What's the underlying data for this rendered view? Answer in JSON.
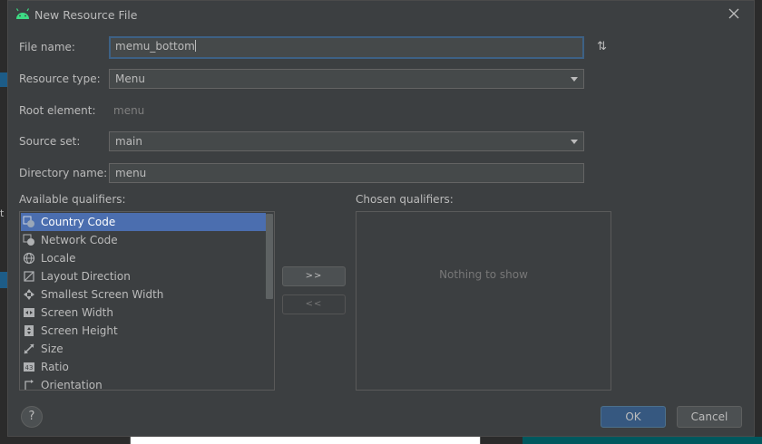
{
  "dialog": {
    "title": "New Resource File",
    "icon": "android-icon"
  },
  "form": {
    "file_name_label": "File name:",
    "file_name_value": "memu_bottom",
    "resource_type_label": "Resource type:",
    "resource_type_value": "Menu",
    "root_element_label": "Root element:",
    "root_element_value": "menu",
    "source_set_label": "Source set:",
    "source_set_value": "main",
    "directory_name_label": "Directory name:",
    "directory_name_value": "menu"
  },
  "qualifiers": {
    "available_label": "Available qualifiers:",
    "chosen_label": "Chosen qualifiers:",
    "items": [
      {
        "label": "Country Code",
        "icon": "country-code-icon",
        "selected": true
      },
      {
        "label": "Network Code",
        "icon": "network-code-icon"
      },
      {
        "label": "Locale",
        "icon": "globe-icon"
      },
      {
        "label": "Layout Direction",
        "icon": "layout-direction-icon"
      },
      {
        "label": "Smallest Screen Width",
        "icon": "smallest-width-icon"
      },
      {
        "label": "Screen Width",
        "icon": "screen-width-icon"
      },
      {
        "label": "Screen Height",
        "icon": "screen-height-icon"
      },
      {
        "label": "Size",
        "icon": "size-icon"
      },
      {
        "label": "Ratio",
        "icon": "ratio-icon"
      },
      {
        "label": "Orientation",
        "icon": "orientation-icon"
      }
    ],
    "add_button": ">>",
    "remove_button": "<<",
    "empty_text": "Nothing to show"
  },
  "footer": {
    "help": "?",
    "ok": "OK",
    "cancel": "Cancel"
  },
  "colors": {
    "selection": "#4b6eaf",
    "dialog_bg": "#3c3f41",
    "ok_button": "#365880"
  }
}
